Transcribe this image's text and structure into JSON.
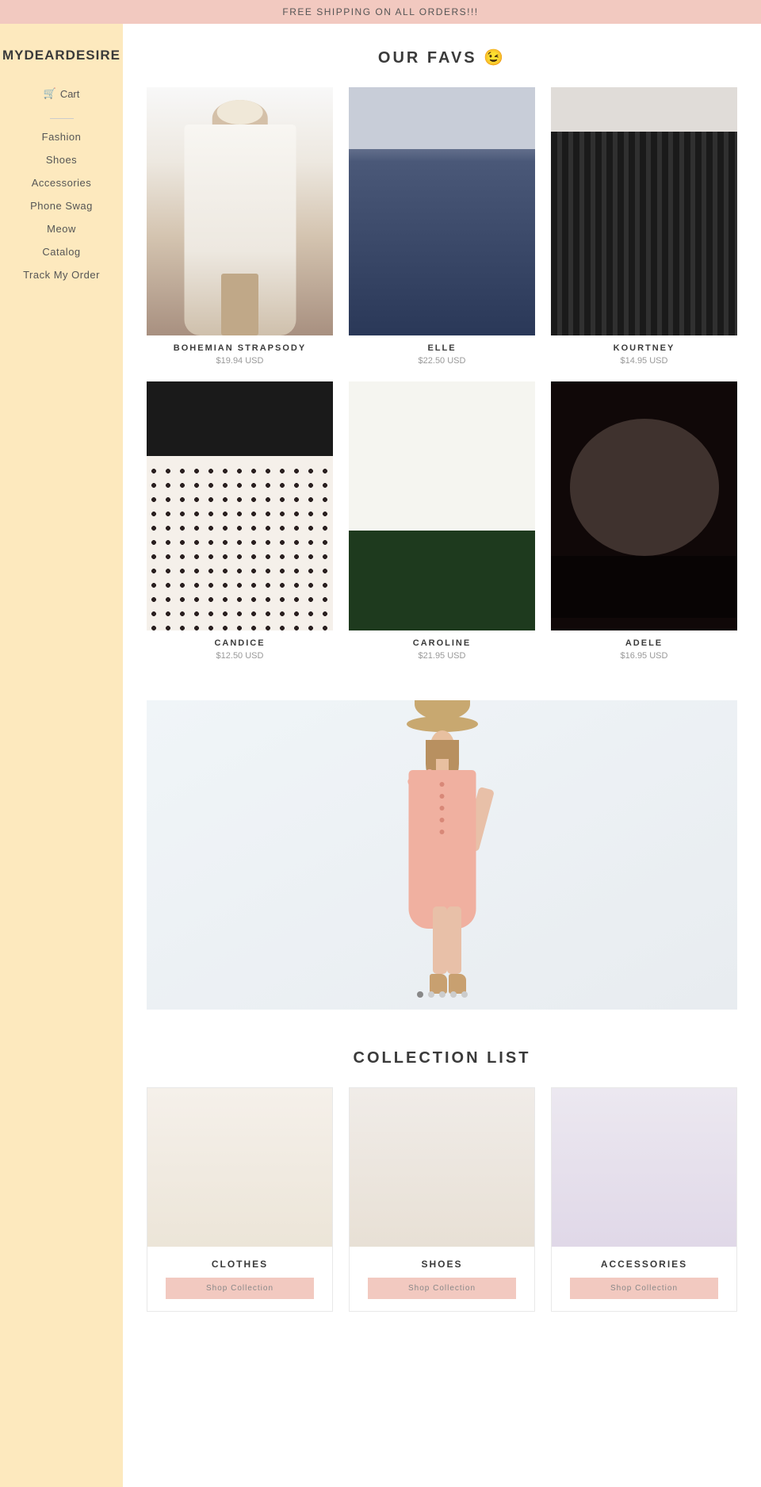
{
  "banner": {
    "text": "FREE SHIPPING ON ALL ORDERS!!!"
  },
  "sidebar": {
    "logo": "MYDEARDESIRE",
    "cart_label": "Cart",
    "nav_items": [
      {
        "label": "Fashion",
        "href": "#"
      },
      {
        "label": "Shoes",
        "href": "#"
      },
      {
        "label": "Accessories",
        "href": "#"
      },
      {
        "label": "Phone Swag",
        "href": "#"
      },
      {
        "label": "Meow",
        "href": "#"
      },
      {
        "label": "Catalog",
        "href": "#"
      },
      {
        "label": "Track My Order",
        "href": "#"
      }
    ]
  },
  "favs_section": {
    "title": "OUR FAVS 😉",
    "products": [
      {
        "id": "bohemian",
        "name": "BOHEMIAN STRAPSODY",
        "price": "$19.94 USD",
        "img_class": "dress-bohemian"
      },
      {
        "id": "elle",
        "name": "ELLE",
        "price": "$22.50 USD",
        "img_class": "dress-elle"
      },
      {
        "id": "kourtney",
        "name": "KOURTNEY",
        "price": "$14.95 USD",
        "img_class": "dress-kourtney"
      },
      {
        "id": "candice",
        "name": "CANDICE",
        "price": "$12.50 USD",
        "img_class": "dress-candice"
      },
      {
        "id": "caroline",
        "name": "CAROLINE",
        "price": "$21.95 USD",
        "img_class": "dress-caroline"
      },
      {
        "id": "adele",
        "name": "ADELE",
        "price": "$16.95 USD",
        "img_class": "dress-adele"
      }
    ]
  },
  "carousel": {
    "dots_count": 5,
    "active_dot": 0
  },
  "collection_section": {
    "title": "COLLECTION LIST",
    "collections": [
      {
        "id": "clothes",
        "name": "CLOTHES",
        "btn_label": "Shop Collection"
      },
      {
        "id": "shoes",
        "name": "SHOES",
        "btn_label": "Shop Collection"
      },
      {
        "id": "accessories",
        "name": "ACCESSORIES",
        "btn_label": "Shop Collection"
      }
    ]
  }
}
